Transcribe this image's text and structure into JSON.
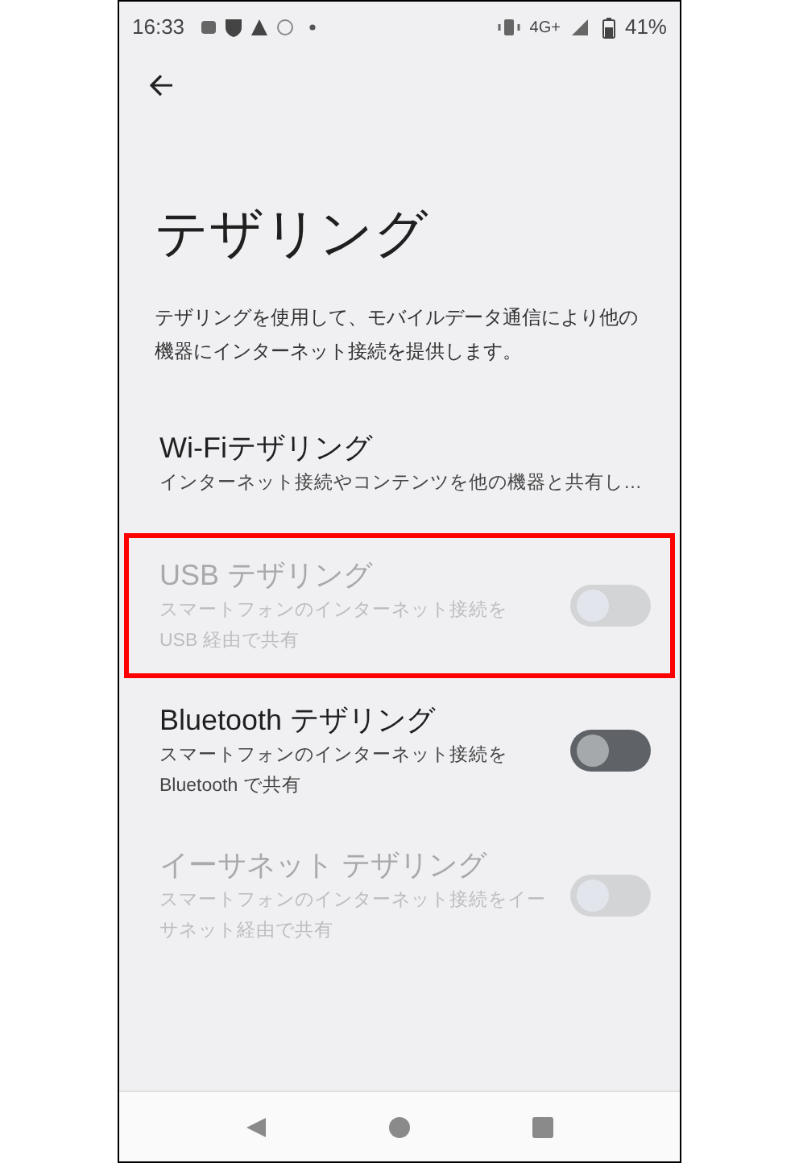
{
  "status_bar": {
    "time": "16:33",
    "network": "4G+",
    "battery": "41%"
  },
  "title": "テザリング",
  "description": "テザリングを使用して、モバイルデータ通信により他の機器にインターネット接続を提供します。",
  "items": [
    {
      "kind": "link",
      "title": "Wi-Fiテザリング",
      "summary": "インターネット接続やコンテンツを他の機器と共有し…",
      "disabled": false,
      "highlighted": false
    },
    {
      "kind": "switch",
      "title": "USB テザリング",
      "summary": "スマートフォンのインターネット接続を\nUSB 経由で共有",
      "disabled": true,
      "on": false,
      "highlighted": true
    },
    {
      "kind": "switch",
      "title": "Bluetooth テザリング",
      "summary": "スマートフォンのインターネット接続を\nBluetooth で共有",
      "disabled": false,
      "on": false,
      "highlighted": false
    },
    {
      "kind": "switch",
      "title": "イーサネット テザリング",
      "summary": "スマートフォンのインターネット接続をイーサネット経由で共有",
      "disabled": true,
      "on": false,
      "highlighted": false
    }
  ]
}
